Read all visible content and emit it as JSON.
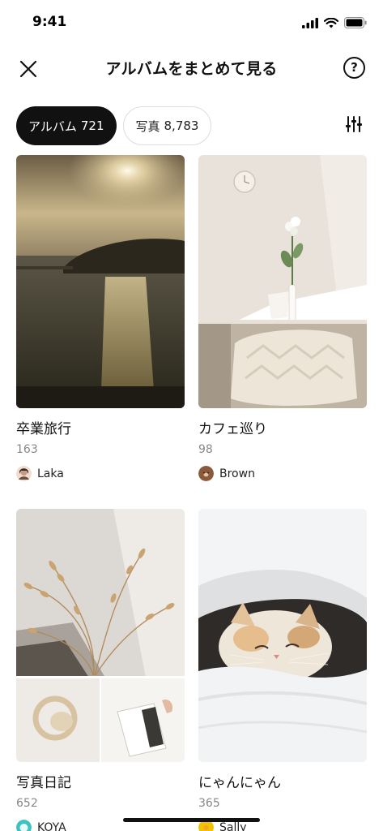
{
  "status_bar": {
    "time": "9:41"
  },
  "header": {
    "title": "アルバムをまとめて見る",
    "help_label": "?"
  },
  "tabs": [
    {
      "label": "アルバム",
      "count": "721",
      "active": true
    },
    {
      "label": "写真",
      "count": "8,783",
      "active": false
    }
  ],
  "albums": [
    {
      "title": "卒業旅行",
      "count": "163",
      "owner": "Laka",
      "avatar_color": "#d9b7a3"
    },
    {
      "title": "カフェ巡り",
      "count": "98",
      "owner": "Brown",
      "avatar_color": "#8a5a3c"
    },
    {
      "title": "写真日記",
      "count": "652",
      "owner": "KOYA",
      "avatar_color": "#3fc1c0"
    },
    {
      "title": "にゃんにゃん",
      "count": "365",
      "owner": "Sally",
      "avatar_color": "#f2c200"
    }
  ],
  "icons": {
    "close": "close-icon",
    "help": "help-icon",
    "filter": "filter-sliders-icon",
    "signal": "cellular-signal-icon",
    "wifi": "wifi-icon",
    "battery": "battery-icon"
  }
}
